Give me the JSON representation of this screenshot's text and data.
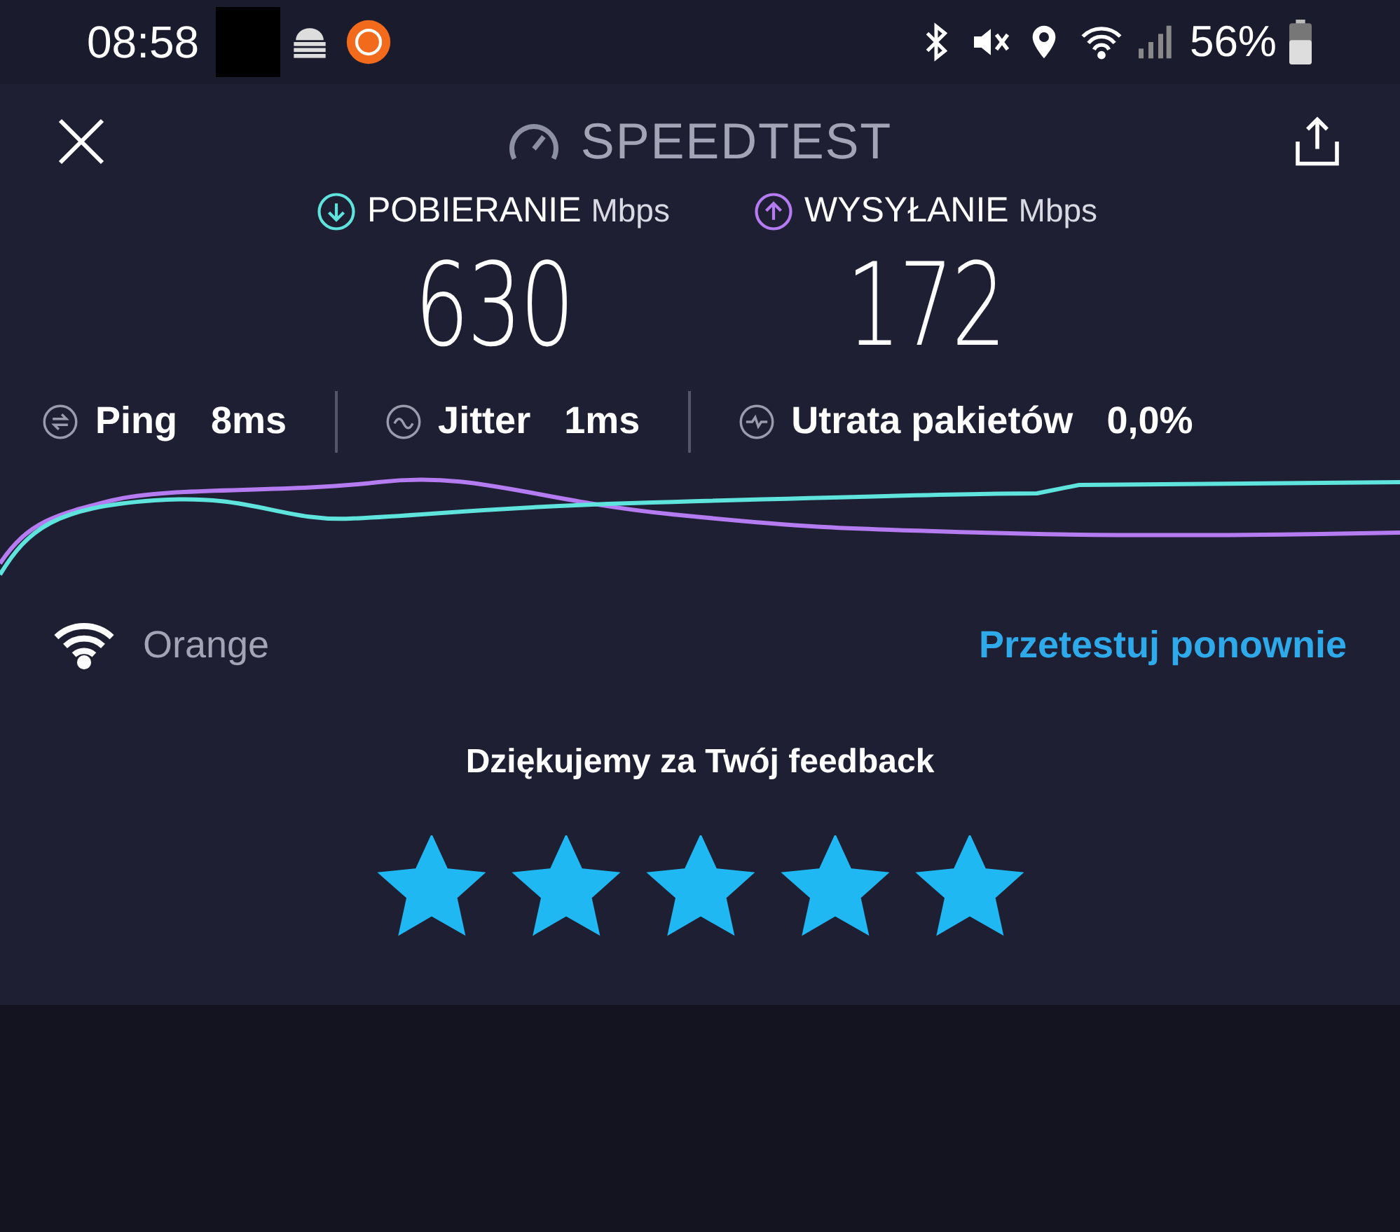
{
  "status_bar": {
    "time": "08:58",
    "battery": "56%"
  },
  "header": {
    "title": "SPEEDTEST"
  },
  "download": {
    "label": "POBIERANIE",
    "unit": "Mbps",
    "value": "630"
  },
  "upload": {
    "label": "WYSYŁANIE",
    "unit": "Mbps",
    "value": "172"
  },
  "metrics": [
    {
      "kind": "ping",
      "label": "Ping",
      "value": "8ms"
    },
    {
      "kind": "jitter",
      "label": "Jitter",
      "value": "1ms"
    },
    {
      "kind": "loss",
      "label": "Utrata pakietów",
      "value": "0,0%"
    }
  ],
  "network": {
    "name": "Orange"
  },
  "retest": "Przetestuj ponownie",
  "feedback": {
    "title": "Dziękujemy za Twój feedback",
    "stars": 5
  }
}
